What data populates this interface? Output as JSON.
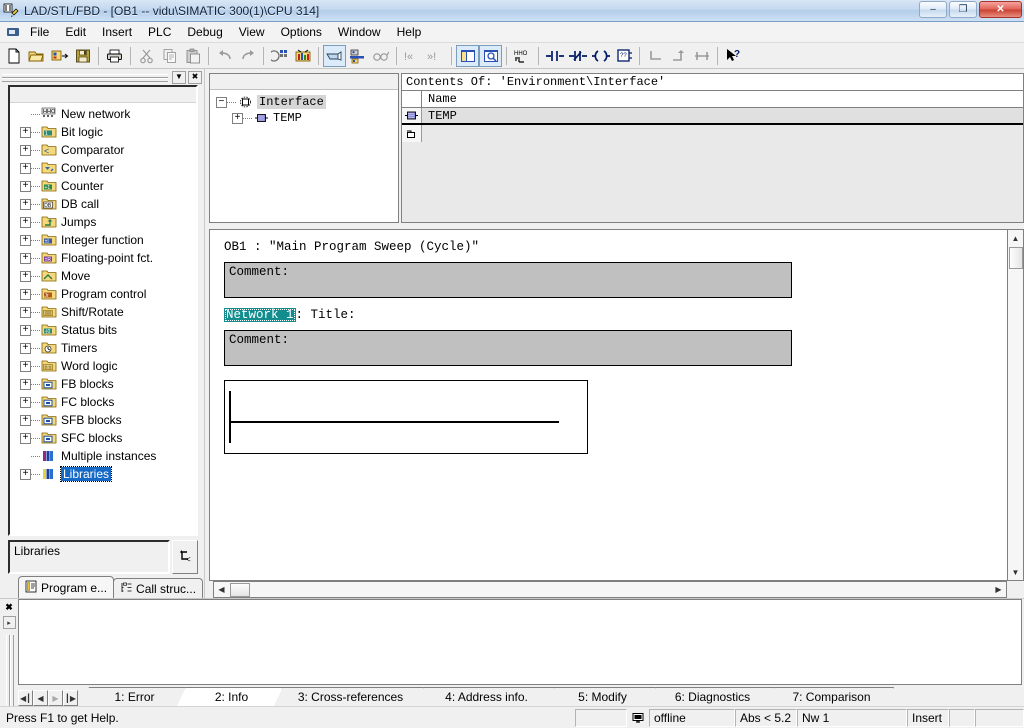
{
  "window": {
    "title": "LAD/STL/FBD  - [OB1 -- vidu\\SIMATIC 300(1)\\CPU 314]",
    "app_icon": "lad-stl-fbd-icon",
    "minimize": "–",
    "maximize": "❐",
    "close": "✕",
    "doc_minimize": "_",
    "doc_restore": "❐",
    "doc_close": "×"
  },
  "menu": {
    "items": [
      {
        "label": "File"
      },
      {
        "label": "Edit"
      },
      {
        "label": "Insert"
      },
      {
        "label": "PLC"
      },
      {
        "label": "Debug"
      },
      {
        "label": "View"
      },
      {
        "label": "Options"
      },
      {
        "label": "Window"
      },
      {
        "label": "Help"
      }
    ]
  },
  "toolbar": {
    "buttons": [
      {
        "name": "new-icon",
        "tip": "New"
      },
      {
        "name": "open-icon",
        "tip": "Open"
      },
      {
        "name": "open-online-icon",
        "tip": "Open online"
      },
      {
        "name": "save-icon",
        "tip": "Save"
      },
      {
        "sep": true
      },
      {
        "name": "print-icon",
        "tip": "Print"
      },
      {
        "sep": true
      },
      {
        "name": "cut-icon",
        "tip": "Cut"
      },
      {
        "name": "copy-icon",
        "tip": "Copy"
      },
      {
        "name": "paste-icon",
        "tip": "Paste"
      },
      {
        "sep": true
      },
      {
        "name": "undo-icon",
        "tip": "Undo"
      },
      {
        "name": "redo-icon",
        "tip": "Redo"
      },
      {
        "sep": true
      },
      {
        "name": "download-icon",
        "tip": "Download"
      },
      {
        "name": "monitor-icon",
        "tip": "Monitor"
      },
      {
        "sep": true
      },
      {
        "name": "symbol-info-icon",
        "tip": "Symbolic representation"
      },
      {
        "name": "symbol-table-icon",
        "tip": "Symbol information"
      },
      {
        "name": "glasses-icon",
        "tip": "Display with"
      },
      {
        "sep": true
      },
      {
        "name": "error-prev-icon",
        "tip": "Previous error"
      },
      {
        "name": "error-next-icon",
        "tip": "Next error"
      },
      {
        "sep": true
      },
      {
        "name": "overviews-icon",
        "tip": "Overviews"
      },
      {
        "name": "zoom-detail-icon",
        "tip": "Details"
      },
      {
        "sep": true
      },
      {
        "name": "new-network-icon",
        "tip": "New network"
      },
      {
        "sep": true
      },
      {
        "name": "contact-no-icon",
        "tip": "Normally open contact"
      },
      {
        "name": "contact-nc-icon",
        "tip": "Normally closed contact"
      },
      {
        "name": "coil-icon",
        "tip": "Output coil"
      },
      {
        "name": "empty-box-icon",
        "tip": "Empty box"
      },
      {
        "sep": true
      },
      {
        "name": "branch-open-icon",
        "tip": "Open branch"
      },
      {
        "name": "branch-close-icon",
        "tip": "Close branch"
      },
      {
        "name": "branch-parallel-icon",
        "tip": "Parallel branch"
      },
      {
        "sep": true
      },
      {
        "name": "help-cursor-icon",
        "tip": "What's This?"
      }
    ]
  },
  "left_panel": {
    "dropdown_glyph": "▼",
    "close_glyph": "✖",
    "tree": [
      {
        "label": "New network",
        "icon": "new-network-icon",
        "expandable": false,
        "selected": false
      },
      {
        "label": "Bit logic",
        "icon": "bit-logic-folder-icon",
        "expandable": true,
        "selected": false
      },
      {
        "label": "Comparator",
        "icon": "comparator-folder-icon",
        "expandable": true,
        "selected": false
      },
      {
        "label": "Converter",
        "icon": "converter-folder-icon",
        "expandable": true,
        "selected": false
      },
      {
        "label": "Counter",
        "icon": "counter-folder-icon",
        "expandable": true,
        "selected": false
      },
      {
        "label": "DB call",
        "icon": "db-call-folder-icon",
        "expandable": true,
        "selected": false
      },
      {
        "label": "Jumps",
        "icon": "jumps-folder-icon",
        "expandable": true,
        "selected": false
      },
      {
        "label": "Integer function",
        "icon": "integer-function-folder-icon",
        "expandable": true,
        "selected": false
      },
      {
        "label": "Floating-point fct.",
        "icon": "floating-point-folder-icon",
        "expandable": true,
        "selected": false
      },
      {
        "label": "Move",
        "icon": "move-folder-icon",
        "expandable": true,
        "selected": false
      },
      {
        "label": "Program control",
        "icon": "program-control-folder-icon",
        "expandable": true,
        "selected": false
      },
      {
        "label": "Shift/Rotate",
        "icon": "shift-rotate-folder-icon",
        "expandable": true,
        "selected": false
      },
      {
        "label": "Status bits",
        "icon": "status-bits-folder-icon",
        "expandable": true,
        "selected": false
      },
      {
        "label": "Timers",
        "icon": "timers-folder-icon",
        "expandable": true,
        "selected": false
      },
      {
        "label": "Word logic",
        "icon": "word-logic-folder-icon",
        "expandable": true,
        "selected": false
      },
      {
        "label": "FB blocks",
        "icon": "fb-blocks-folder-icon",
        "expandable": true,
        "selected": false
      },
      {
        "label": "FC blocks",
        "icon": "fc-blocks-folder-icon",
        "expandable": true,
        "selected": false
      },
      {
        "label": "SFB blocks",
        "icon": "sfb-blocks-folder-icon",
        "expandable": true,
        "selected": false
      },
      {
        "label": "SFC blocks",
        "icon": "sfc-blocks-folder-icon",
        "expandable": true,
        "selected": false
      },
      {
        "label": "Multiple instances",
        "icon": "multiple-instances-icon",
        "expandable": false,
        "selected": false
      },
      {
        "label": "Libraries",
        "icon": "libraries-icon",
        "expandable": true,
        "selected": true
      }
    ],
    "combo_value": "Libraries",
    "combo_button_icon": "jump-up-icon",
    "tabs": [
      {
        "label": "Program e...",
        "icon": "program-elements-icon",
        "active": true
      },
      {
        "label": "Call struc...",
        "icon": "call-structure-icon",
        "active": false
      }
    ]
  },
  "declaration": {
    "tree": [
      {
        "label": "Interface",
        "icon": "interface-icon",
        "expander": "−",
        "depth": 0,
        "selected": true
      },
      {
        "label": "TEMP",
        "icon": "temp-var-icon",
        "expander": "+",
        "depth": 1,
        "selected": false
      }
    ],
    "contents_title": "Contents Of: 'Environment\\Interface'",
    "columns": [
      "Name"
    ],
    "rows": [
      {
        "icon": "temp-var-icon",
        "name": "TEMP",
        "selected": true
      },
      {
        "icon": "new-row-icon",
        "name": "",
        "selected": false
      }
    ]
  },
  "editor": {
    "block_title": "OB1 :   \"Main Program Sweep (Cycle)\"",
    "block_comment": "Comment:",
    "network_chip": "Network 1",
    "network_title": ": Title:",
    "network_comment": "Comment:",
    "rung": {
      "empty": true
    }
  },
  "output_panel": {
    "nav": [
      {
        "glyph": "◀┃",
        "name": "first-tab-button",
        "disabled": false
      },
      {
        "glyph": "◀",
        "name": "prev-tab-button",
        "disabled": false
      },
      {
        "glyph": "▶",
        "name": "next-tab-button",
        "disabled": true
      },
      {
        "glyph": "┃▶",
        "name": "last-tab-button",
        "disabled": false
      }
    ],
    "tabs": [
      {
        "label": "1: Error",
        "active": false
      },
      {
        "label": "2: Info",
        "active": true
      },
      {
        "label": "3: Cross-references",
        "active": false
      },
      {
        "label": "4: Address info.",
        "active": false
      },
      {
        "label": "5: Modify",
        "active": false
      },
      {
        "label": "6: Diagnostics",
        "active": false
      },
      {
        "label": "7: Comparison",
        "active": false
      }
    ],
    "content": "",
    "close_glyph": "✖",
    "expand_glyph": "▸"
  },
  "statusbar": {
    "message": "Press F1 to get Help.",
    "cells": [
      {
        "name": "status-blank-1",
        "value": ""
      },
      {
        "name": "status-connection-icon",
        "value": ""
      },
      {
        "name": "status-mode",
        "value": "offline"
      },
      {
        "name": "status-address",
        "value": "Abs < 5.2"
      },
      {
        "name": "status-network",
        "value": "Nw 1"
      },
      {
        "name": "status-insert-mode",
        "value": "Insert"
      },
      {
        "name": "status-blank-2",
        "value": ""
      },
      {
        "name": "status-blank-3",
        "value": ""
      }
    ]
  },
  "colors": {
    "title_accent": "#b4cdea",
    "selection_blue": "#1569c7",
    "network_chip": "#128c8c",
    "comment_gray": "#c0c0c0",
    "window_bg": "#f0f0f0"
  }
}
